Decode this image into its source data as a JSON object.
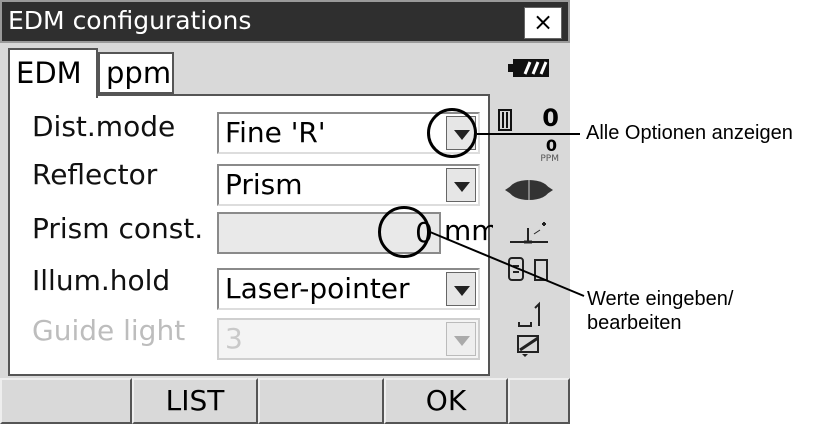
{
  "window": {
    "title": "EDM configurations",
    "close_label": "×"
  },
  "tabs": [
    {
      "label": "EDM",
      "active": true
    },
    {
      "label": "ppm",
      "active": false
    }
  ],
  "form": {
    "dist_mode": {
      "label": "Dist.mode",
      "value": "Fine 'R'"
    },
    "reflector": {
      "label": "Reflector",
      "value": "Prism"
    },
    "prism_const": {
      "label": "Prism const.",
      "value": "0",
      "unit": "mm"
    },
    "illum_hold": {
      "label": "Illum.hold",
      "value": "Laser-pointer"
    },
    "guide_light": {
      "label": "Guide light",
      "value": "3",
      "disabled": true
    }
  },
  "status_bar": {
    "battery_icon": "battery-icon",
    "prism_const_value": "0",
    "ppm_value": "0",
    "ppm_label": "PPM"
  },
  "softkeys": [
    "",
    "LIST",
    "",
    "OK",
    ""
  ],
  "annotations": {
    "show_options": "Alle Optionen anzeigen",
    "enter_values_line1": "Werte eingeben/",
    "enter_values_line2": "bearbeiten"
  }
}
